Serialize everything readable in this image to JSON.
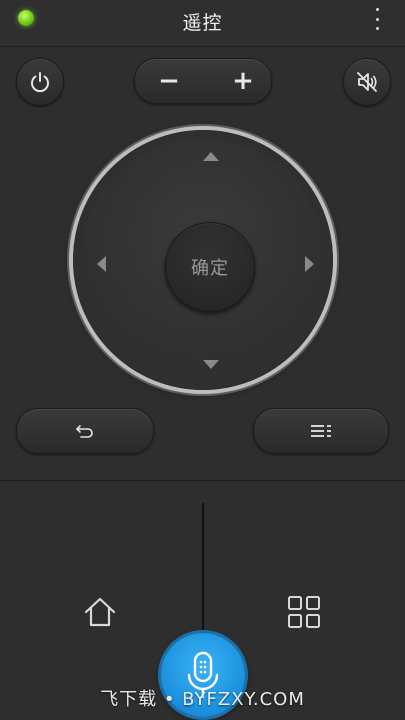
{
  "header": {
    "title": "遥控",
    "status_color": "#7cd420"
  },
  "controls": {
    "power_icon": "power-icon",
    "volume_minus": "−",
    "volume_plus": "+",
    "mute_icon": "mute-icon"
  },
  "dpad": {
    "ok_label": "确定"
  },
  "buttons": {
    "back_icon": "back-icon",
    "menu_icon": "menu-icon"
  },
  "bottom": {
    "home_icon": "home-icon",
    "apps_icon": "apps-icon",
    "voice_icon": "microphone-icon",
    "voice_color": "#1a8fdc"
  },
  "watermark": "飞下载 • BYFZXY.COM"
}
